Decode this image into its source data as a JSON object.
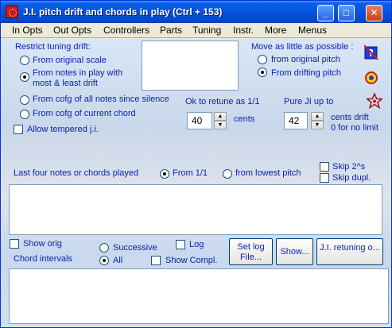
{
  "window": {
    "title": "J.I. pitch drift and chords in play (Ctrl + 153)",
    "minimize": "_",
    "maximize": "□",
    "close": "✕"
  },
  "menu": [
    "In Opts",
    "Out Opts",
    "Controllers",
    "Parts",
    "Tuning",
    "Instr.",
    "More",
    "Menus"
  ],
  "drift": {
    "heading": "Restrict tuning drift:",
    "from_original_scale": "From original scale",
    "from_notes_line1": "From notes in play with",
    "from_notes_line2": "most & least drift",
    "from_cofg_all": "From cofg of all notes since silence",
    "from_cofg_current": "From cofg of current chord",
    "allow_tempered": "Allow tempered j.i."
  },
  "move": {
    "heading": "Move as little as possible :",
    "from_original_pitch": "from original pitch",
    "from_drifting_pitch": "From drifting pitch"
  },
  "retune": {
    "label": "Ok to retune as 1/1",
    "value": "40",
    "unit": "cents"
  },
  "pure_ji": {
    "label": "Pure JI up to",
    "value": "42",
    "unit_line1": "cents drift",
    "unit_line2": "0 for no limit"
  },
  "last_four": {
    "label": "Last four notes or chords played",
    "from_11": "From 1/1",
    "from_lowest": "from lowest pitch",
    "skip_2s": "Skip 2^s",
    "skip_dupl": "Skip dupl."
  },
  "bottom": {
    "show_orig": "Show orig",
    "chord_intervals": "Chord intervals",
    "successive": "Successive",
    "all": "All",
    "log": "Log",
    "show_compl": "Show Compl.",
    "set_log_line1": "Set log",
    "set_log_line2": "File...",
    "show_button": "Show...",
    "ji_retuning_button": "J.I. retuning o..."
  },
  "colors": {
    "title_bar": "#0553e0",
    "label_blue": "#0a1eb0",
    "icon_red": "#d01818",
    "icon_yellow": "#f5d800"
  }
}
